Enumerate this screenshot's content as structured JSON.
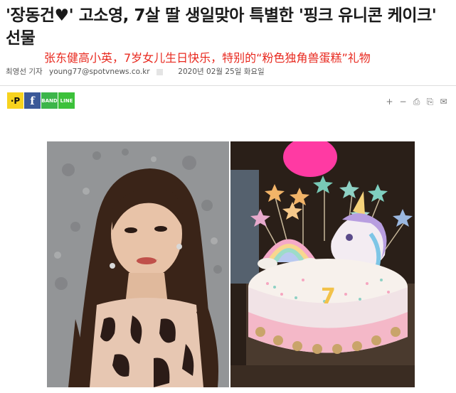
{
  "article": {
    "headline": "'장동건♥' 고소영, 7살 딸 생일맞아 특별한 '핑크 유니콘 케이크' 선물",
    "cn_overlay": "张东健高小英，7岁女儿生日快乐，特别的“粉色独角兽蛋糕”礼物",
    "byline": {
      "reporter": "최영선 기자",
      "email": "young77@spotvnews.co.kr",
      "date": "2020년 02월 25일 화요일"
    }
  },
  "share": {
    "p_label": "·P",
    "f_label": "f",
    "band_label": "BAND",
    "line_label": "LINE"
  },
  "tools": {
    "zoom_in": "+",
    "zoom_out": "−",
    "print": "⎙",
    "share": "⎘",
    "mail": "✉"
  },
  "icons": [
    "plus-icon",
    "minus-icon",
    "print-icon",
    "copy-icon",
    "mail-icon"
  ],
  "colors": {
    "headline": "#1a1a1a",
    "cn_overlay": "#e8281e",
    "facebook": "#3b5998",
    "band": "#3cb54a",
    "line": "#3cc13a",
    "p_button": "#f7d31e"
  }
}
